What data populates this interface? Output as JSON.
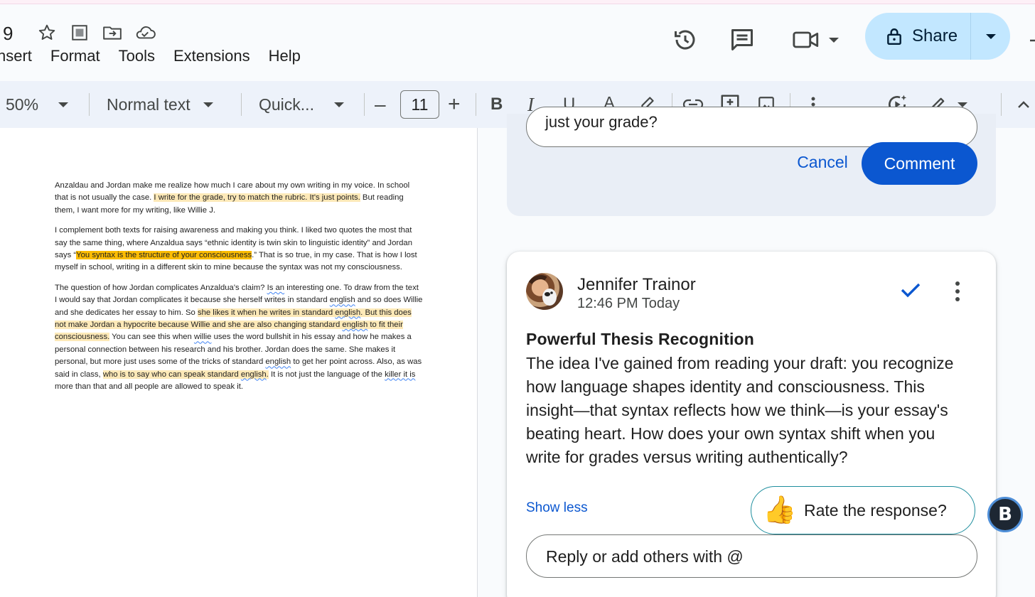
{
  "header": {
    "doc_title_fragment": "9",
    "menu": [
      "nsert",
      "Format",
      "Tools",
      "Extensions",
      "Help"
    ],
    "share_label": "Share"
  },
  "toolbar": {
    "zoom": "50%",
    "style": "Normal text",
    "font": "Quick...",
    "font_size": "11",
    "decrease": "–",
    "increase": "+",
    "bold": "B",
    "italic": "I",
    "underline": "U",
    "text_color": "A"
  },
  "document": {
    "p1": {
      "a": "Anzaldau and Jordan make me realize how much I care about my own writing in my voice. In school that is not usually the case. ",
      "hl": "I write for the grade, try to match the rubric. It's just points.",
      "b": " But reading them, I want more for my writing, like Willie J."
    },
    "p2": {
      "a": "I complement both texts for raising awareness and making you think. I liked two quotes the most that say the same thing, where Anzaldua says “ethnic identity is twin skin to linguistic identity” and Jordan says “",
      "hl": "You syntax is the structure of your consciousness",
      "b": ".” That is so true, in my case. That is how I lost myself in school, writing in a different skin to mine because the syntax was not my consciousness."
    },
    "p3": {
      "a": "The question of how Jordan complicates Anzaldua's claim? ",
      "s1": "Is an",
      "b": " interesting one. To draw from the text I would say that Jordan complicates it because she herself writes in standard ",
      "s2": "english",
      "c": " and so does Willie and she dedicates her essay to him. So ",
      "hl1a": "she likes it when he writes in standard ",
      "s3": "english",
      "hl1b": ". But this does not make Jordan a hypocrite because Willie and she are also changing standard ",
      "s4": "english",
      "hl1c": " to fit their consciousness.",
      "d": " You can see this when ",
      "s5": "willie",
      "e": " uses the word bullshit in his essay and how he makes a personal connection between his research and his brother. Jordan does the same. She makes it personal, but more just uses some of the tricks of standard ",
      "s6": "english",
      "f": " to get her point across. Also, as was said in class, ",
      "hl2a": "who is to say who can speak standard ",
      "s7": "english",
      "hl2b": ".",
      "g": " It is not just the language of the ",
      "s8": "killer it is",
      "h": " more than that and all people are allowed to speak it."
    }
  },
  "draft": {
    "input_text": "just your grade?",
    "cancel_label": "Cancel",
    "comment_label": "Comment"
  },
  "comment": {
    "author": "Jennifer Trainor",
    "time": "12:46 PM Today",
    "title": "Powerful Thesis Recognition",
    "body": "The idea I've gained from reading your draft: you recognize how language shapes identity and consciousness. This insight—that syntax reflects how we think—is your essay's beating heart. How does your own syntax shift when you write for grades versus writing authentically?",
    "show_less": "Show less",
    "reply_placeholder": "Reply or add others with @"
  },
  "rate": {
    "emoji": "👍",
    "label": "Rate the response?"
  },
  "fab_letter": "B",
  "colors": {
    "accent": "#0b57d0",
    "share_bg": "#c2e7ff",
    "highlight": "#fde9b8",
    "highlight_active": "#fbbc04"
  }
}
